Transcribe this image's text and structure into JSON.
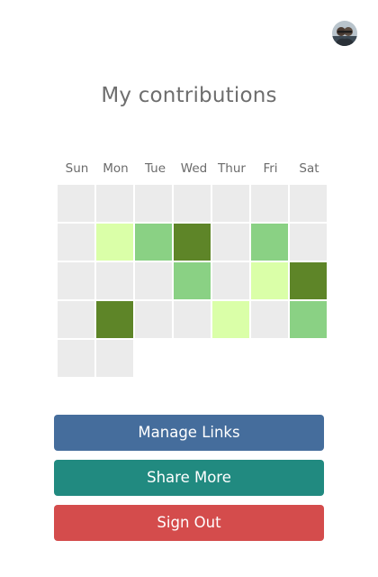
{
  "header": {
    "avatar_icon": "user-avatar-photo"
  },
  "title": "My contributions",
  "days": [
    "Sun",
    "Mon",
    "Tue",
    "Wed",
    "Thur",
    "Fri",
    "Sat"
  ],
  "contributions": {
    "weeks": [
      [
        0,
        0,
        0,
        0,
        0,
        0,
        0
      ],
      [
        0,
        1,
        2,
        3,
        0,
        2,
        0
      ],
      [
        0,
        0,
        0,
        2,
        0,
        1,
        3
      ],
      [
        0,
        3,
        0,
        0,
        1,
        0,
        2
      ],
      [
        0,
        0
      ]
    ],
    "level_colors": [
      "#ebebeb",
      "#daffa8",
      "#8ad184",
      "#5e8528"
    ]
  },
  "buttons": {
    "manage_links": "Manage Links",
    "share_more": "Share More",
    "sign_out": "Sign Out"
  },
  "colors": {
    "manage_links": "#456d9c",
    "share_more": "#218a80",
    "sign_out": "#d44c4c"
  }
}
